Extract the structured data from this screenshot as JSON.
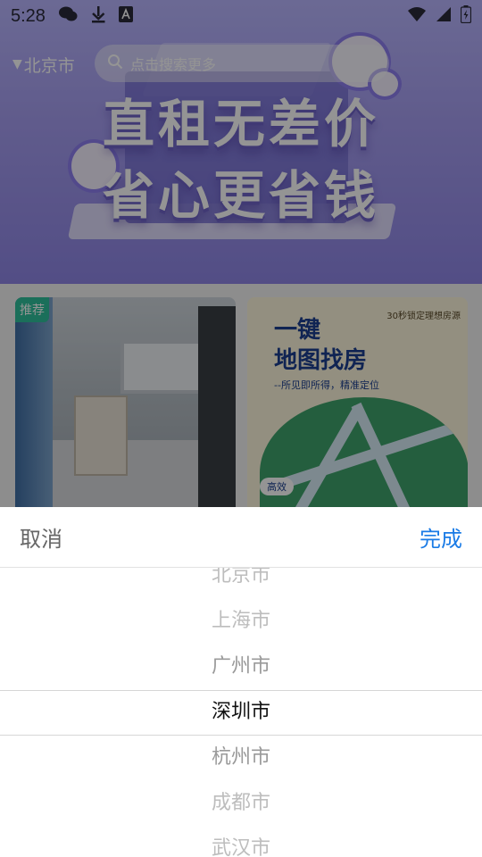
{
  "status_bar": {
    "time": "5:28",
    "left_icons": [
      "wechat-icon",
      "download-icon",
      "a-icon"
    ],
    "right_icons": [
      "wifi-icon",
      "signal-icon",
      "battery-icon"
    ]
  },
  "header": {
    "city": "北京市",
    "search_placeholder": "点击搜索更多"
  },
  "banner": {
    "headline_line1": "直租无差价",
    "headline_line2": "省心更省钱"
  },
  "cards": {
    "room": {
      "badge": "推荐"
    },
    "map": {
      "title_line1": "一键",
      "title_line2": "地图找房",
      "subtitle": "--所见即所得，精准定位",
      "top_note": "30秒锁定理想房源",
      "chip": "高效"
    }
  },
  "picker": {
    "cancel_label": "取消",
    "done_label": "完成",
    "selected_index": 3,
    "options": [
      "北京市",
      "上海市",
      "广州市",
      "深圳市",
      "杭州市",
      "成都市",
      "武汉市"
    ]
  },
  "colors": {
    "accent": "#1a7be6",
    "badge": "#2fbf9b",
    "banner": "#a79ff2"
  }
}
